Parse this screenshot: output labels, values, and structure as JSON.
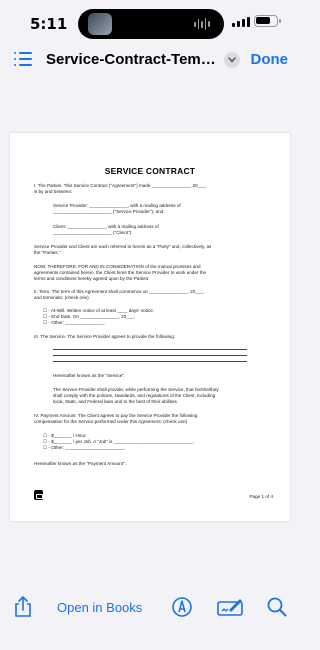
{
  "status_bar": {
    "time": "5:11"
  },
  "nav": {
    "title": "Service-Contract-Templat...",
    "done_label": "Done"
  },
  "document": {
    "title": "SERVICE CONTRACT",
    "page_number": "Page 1 of 4",
    "lines": [
      "I. The Parties. This Service Contract (\"Agreement\") made _______________, 20___,",
      "is by and between:",
      "Service Provider: _______________, with a mailing address of",
      "_______________________ (\"Service Provider\"), and",
      "Client: _______________, with a mailing address of",
      "_______________________ (\"Client\").",
      "Service Provider and Client are each referred to herein as a \"Party\" and, collectively, as",
      "the \"Parties.\"",
      "NOW, THEREFORE, FOR AND IN CONSIDERATION of the mutual promises and",
      "agreements contained herein, the Client hires the Service Provider to work under the",
      "terms and conditions hereby agreed upon by the Parties:",
      "II. Term. The term of this Agreement shall commence on _______________, 20___,",
      "and terminate: (check one)",
      "☐ - At-Will. Written notice of at least ____ days' notice.",
      "☐ - End Date. On _______________, 20___.",
      "☐ - Other: _______________.",
      "III. The Service. The Service Provider agrees to provide the following:",
      "Hereinafter known as the \"Service\".",
      "The Service Provider shall provide, while performing the Service, that he/she/they",
      "shall comply with the policies, standards, and regulations of the Client, including",
      "local, State, and Federal laws and to the best of their abilities.",
      "IV. Payment Amount. The Client agrees to pay the Service Provider the following",
      "compensation for the Service performed under this Agreement: (check one)",
      "☐ - $_______ / Hour.",
      "☐ - $_______ / per Job. A \"Job\" is _______________________________.",
      "☐ - Other: _______________________.",
      "Hereinafter known as the \"Payment Amount\"."
    ]
  },
  "toolbar": {
    "books_label": "Open in Books"
  },
  "colors": {
    "accent": "#1a73e8",
    "background": "#f2f2f7"
  },
  "icons": [
    "list-icon",
    "chevron-down-icon",
    "share-icon",
    "markup-icon",
    "sign-icon",
    "search-icon"
  ]
}
